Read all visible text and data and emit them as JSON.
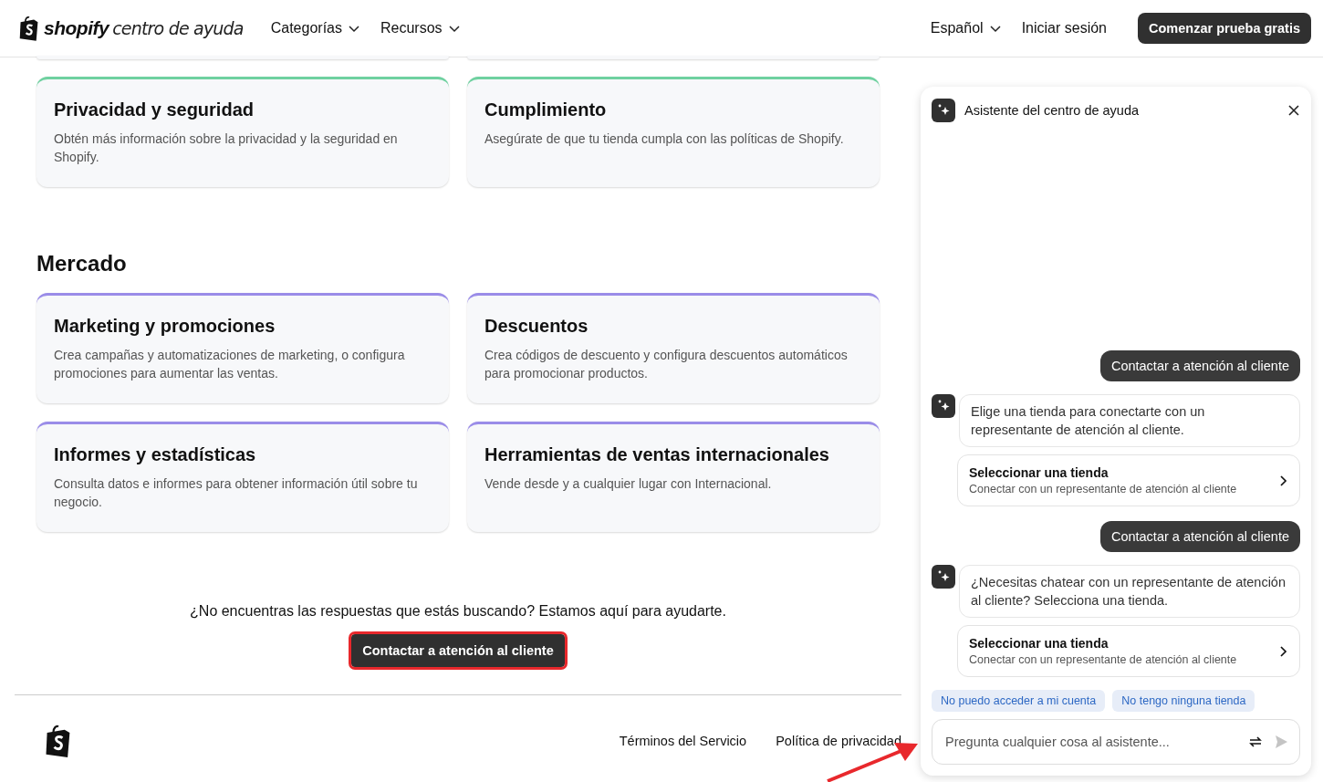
{
  "header": {
    "brand": "shopify",
    "subtitle": "centro de ayuda",
    "nav": [
      {
        "label": "Categorías"
      },
      {
        "label": "Recursos"
      }
    ],
    "language": "Español",
    "login": "Iniciar sesión",
    "cta": "Comenzar prueba gratis"
  },
  "sections": [
    {
      "color": "#6fd1a0",
      "cards": [
        {
          "title": "Privacidad y seguridad",
          "description": "Obtén más información sobre la privacidad y la seguridad en Shopify."
        },
        {
          "title": "Cumplimiento",
          "description": "Asegúrate de que tu tienda cumpla con las políticas de Shopify."
        }
      ]
    },
    {
      "heading": "Mercado",
      "color": "#9a8ce8",
      "cards": [
        {
          "title": "Marketing y promociones",
          "description": "Crea campañas y automatizaciones de marketing, o configura promociones para aumentar las ventas."
        },
        {
          "title": "Descuentos",
          "description": "Crea códigos de descuento y configura descuentos automáticos para promocionar productos."
        },
        {
          "title": "Informes y estadísticas",
          "description": "Consulta datos e informes para obtener información útil sobre tu negocio."
        },
        {
          "title": "Herramientas de ventas internacionales",
          "description": "Vende desde y a cualquier lugar con Internacional."
        }
      ]
    }
  ],
  "help": {
    "text": "¿No encuentras las respuestas que estás buscando? Estamos aquí para ayudarte.",
    "button": "Contactar a atención al cliente",
    "highlighted": true
  },
  "footer": {
    "links": [
      "Términos del Servicio",
      "Política de privacidad"
    ]
  },
  "annotation_arrow": true,
  "assistant": {
    "title": "Asistente del centro de ayuda",
    "messages": [
      {
        "kind": "user",
        "text": "Contactar a atención al cliente"
      },
      {
        "kind": "bot",
        "text": "Elige una tienda para conectarte con un representante de atención al cliente."
      },
      {
        "kind": "option",
        "title": "Seleccionar una tienda",
        "subtitle": "Conectar con un representante de atención al cliente"
      },
      {
        "kind": "user",
        "text": "Contactar a atención al cliente"
      },
      {
        "kind": "bot",
        "text": "¿Necesitas chatear con un representante de atención al cliente? Selecciona una tienda."
      },
      {
        "kind": "option",
        "title": "Seleccionar una tienda",
        "subtitle": "Conectar con un representante de atención al cliente"
      }
    ],
    "suggestions": [
      "No puedo acceder a mi cuenta",
      "No tengo ninguna tienda"
    ],
    "input": {
      "placeholder": "Pregunta cualquier cosa al asistente..."
    }
  }
}
